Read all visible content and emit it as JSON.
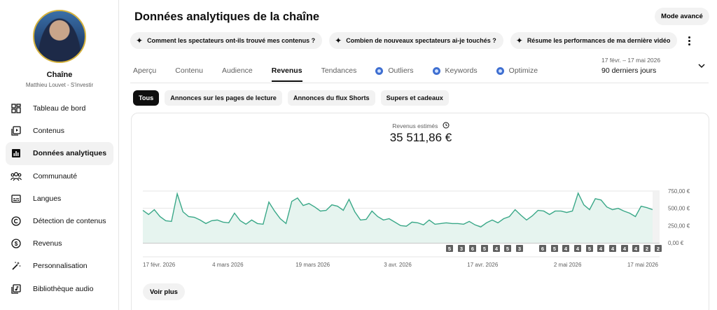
{
  "sidebar": {
    "channel_label": "Chaîne",
    "channel_owner": "Matthieu Louvet - S'investir",
    "items": [
      {
        "label": "Tableau de bord",
        "icon": "dashboard-icon"
      },
      {
        "label": "Contenus",
        "icon": "content-icon"
      },
      {
        "label": "Données analytiques",
        "icon": "analytics-icon"
      },
      {
        "label": "Communauté",
        "icon": "community-icon"
      },
      {
        "label": "Langues",
        "icon": "subtitles-icon"
      },
      {
        "label": "Détection de contenus",
        "icon": "copyright-icon"
      },
      {
        "label": "Revenus",
        "icon": "dollar-icon"
      },
      {
        "label": "Personnalisation",
        "icon": "magic-wand-icon"
      },
      {
        "label": "Bibliothèque audio",
        "icon": "audio-library-icon"
      }
    ],
    "active_index": 2
  },
  "header": {
    "title": "Données analytiques de la chaîne",
    "mode_button": "Mode avancé",
    "suggestions": [
      "Comment les spectateurs ont-ils trouvé mes contenus ?",
      "Combien de nouveaux spectateurs ai-je touchés ?",
      "Résume les performances de ma dernière vidéo"
    ]
  },
  "tabs": {
    "items": [
      {
        "label": "Aperçu",
        "badge": false
      },
      {
        "label": "Contenu",
        "badge": false
      },
      {
        "label": "Audience",
        "badge": false
      },
      {
        "label": "Revenus",
        "badge": false
      },
      {
        "label": "Tendances",
        "badge": false
      },
      {
        "label": "Outliers",
        "badge": true
      },
      {
        "label": "Keywords",
        "badge": true
      },
      {
        "label": "Optimize",
        "badge": true
      }
    ],
    "active_index": 3
  },
  "date_range": {
    "range": "17 févr. – 17 mai 2026",
    "label": "90 derniers jours"
  },
  "filters": {
    "items": [
      "Tous",
      "Annonces sur les pages de lecture",
      "Annonces du flux Shorts",
      "Supers et cadeaux"
    ],
    "active_index": 0
  },
  "metric": {
    "label": "Revenus estimés",
    "value": "35 511,86 €"
  },
  "see_more": "Voir plus",
  "colors": {
    "series_line": "#3aa888",
    "series_fill": "#e6f4ef",
    "accent_badge": "#3f6fd1",
    "active_chip": "#0f0f0f"
  },
  "chart_data": {
    "type": "area",
    "ylim": [
      0,
      750
    ],
    "y_ticks": [
      "0,00 €",
      "250,00 €",
      "500,00 €",
      "750,00 €"
    ],
    "y_tick_values": [
      0,
      250,
      500,
      750
    ],
    "x_ticks": [
      "17 févr. 2026",
      "4 mars 2026",
      "19 mars 2026",
      "3 avr. 2026",
      "17 avr. 2026",
      "2 mai 2026",
      "17 mai 2026"
    ],
    "grid": true,
    "series": [
      {
        "values": [
          470,
          410,
          480,
          380,
          320,
          310,
          710,
          450,
          380,
          370,
          330,
          280,
          320,
          330,
          300,
          290,
          430,
          320,
          270,
          330,
          280,
          270,
          590,
          460,
          350,
          280,
          600,
          650,
          540,
          570,
          520,
          460,
          470,
          550,
          530,
          470,
          630,
          450,
          330,
          340,
          460,
          380,
          330,
          350,
          300,
          250,
          240,
          300,
          290,
          260,
          330,
          270,
          280,
          290,
          280,
          280,
          270,
          310,
          260,
          230,
          290,
          330,
          290,
          350,
          380,
          480,
          400,
          330,
          390,
          470,
          460,
          410,
          460,
          460,
          440,
          460,
          720,
          550,
          480,
          640,
          620,
          520,
          480,
          500,
          460,
          430,
          380,
          530,
          510,
          480
        ]
      }
    ],
    "markers": [
      {
        "index": 50,
        "value": "5"
      },
      {
        "index": 54,
        "value": "3"
      },
      {
        "index": 57,
        "value": "6"
      },
      {
        "index": 61,
        "value": "5"
      },
      {
        "index": 64,
        "value": "4"
      },
      {
        "index": 67,
        "value": "5"
      },
      {
        "index": 70,
        "value": "3"
      },
      {
        "index": 73,
        "value": "6"
      },
      {
        "index": 76,
        "value": "5"
      },
      {
        "index": 79,
        "value": "4"
      },
      {
        "index": 82,
        "value": "4"
      },
      {
        "index": 85,
        "value": "5"
      },
      {
        "index": 86,
        "value": "4"
      },
      {
        "index": 87,
        "value": "4"
      },
      {
        "index": 88,
        "value": "4"
      },
      {
        "index": 89,
        "value": "4"
      },
      {
        "index": 89.3,
        "value": "2"
      },
      {
        "index": 89.6,
        "value": "2"
      }
    ]
  }
}
